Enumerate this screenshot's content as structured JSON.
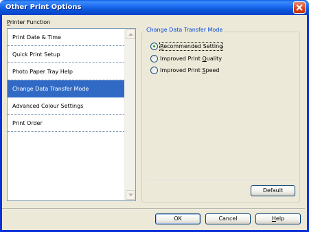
{
  "window": {
    "title": "Other Print Options"
  },
  "printer_function": {
    "label": "Printer Function",
    "label_hotkey": "P",
    "label_rest": "rinter Function",
    "items": [
      {
        "label": "Print Date & Time",
        "selected": false
      },
      {
        "label": "Quick Print Setup",
        "selected": false
      },
      {
        "label": "Photo Paper Tray Help",
        "selected": false
      },
      {
        "label": "Change Data Transfer Mode",
        "selected": true
      },
      {
        "label": "Advanced Colour Settings",
        "selected": false
      },
      {
        "label": "Print Order",
        "selected": false
      }
    ]
  },
  "transfer_mode": {
    "legend": "Change Data Transfer Mode",
    "options": [
      {
        "pre": "",
        "hotkey": "R",
        "post": "ecommended Setting",
        "label": "Recommended Setting",
        "selected": true
      },
      {
        "pre": "Improved Print ",
        "hotkey": "Q",
        "post": "uality",
        "label": "Improved Print Quality",
        "selected": false
      },
      {
        "pre": "Improved Print ",
        "hotkey": "S",
        "post": "peed",
        "label": "Improved Print Speed",
        "selected": false
      }
    ],
    "default_button": "Default"
  },
  "footer": {
    "ok": "OK",
    "cancel": "Cancel",
    "help_hotkey": "H",
    "help_rest": "elp",
    "help": "Help"
  },
  "colors": {
    "selection": "#316AC5",
    "title_bar": "#0A52D6",
    "legend_text": "#0046D5",
    "radio_dot": "#21A121"
  }
}
